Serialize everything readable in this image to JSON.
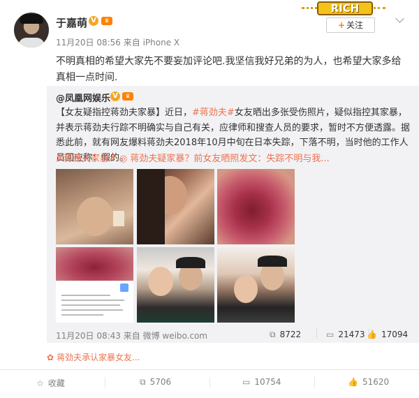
{
  "post": {
    "author": "于嘉萌",
    "author_badge": "V",
    "meta": "11月20日 08:56 来自 iPhone X",
    "follow_label": "关注",
    "follow_plus": "+",
    "text": "不明真相的希望大家先不要妄加评论吧.我坚信我好兄弟的为人，也希望大家多给真相一点时间."
  },
  "brand_sticker": "RICH",
  "repost": {
    "author": "@凤凰网娱乐",
    "author_badge": "V",
    "text_p1": "【女友疑指控蒋劲夫家暴】近日，",
    "tag1": "#蒋劲夫#",
    "text_p2": "女友晒出多张受伤照片，疑似指控其家暴，并表示蒋劲夫行踪不明确实与自己有关，应律师和搜查人员的要求，暂时不方便透露。据悉此前，就有网友爆料蒋劲夫2018年10月中旬在日本失踪，下落不明，当时他的工作人员回应称：假的。",
    "more_line": "#蒋劲夫家暴# ◎ 蒋劲夫疑家暴？前女友晒照发文：失踪不明与我...",
    "footer": "11月20日 08:43 来自 微博 weibo.com",
    "forward_count": "8722",
    "comment_count": "21473",
    "like_count": "17094"
  },
  "tag_line": "蒋劲夫承认家暴女友...",
  "actions": {
    "favorite_label": "收藏",
    "forward_count": "5706",
    "comment_count": "10754",
    "like_count": "51620"
  },
  "colors": {
    "accent": "#eb7350",
    "brand_orange": "#ff8200",
    "verified_gold": "#f5a623",
    "repost_bg": "#f2f2f5"
  },
  "icons": [
    "chevron-down-icon",
    "forward-icon",
    "comment-icon",
    "like-icon",
    "favorite-icon",
    "tag-icon"
  ]
}
